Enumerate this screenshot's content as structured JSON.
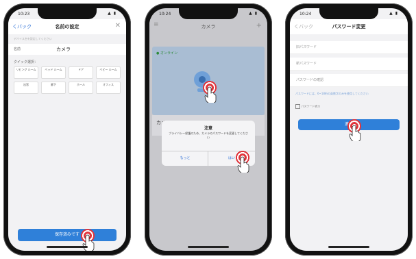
{
  "phone1": {
    "time": "10:23",
    "nav_back": "くバック",
    "nav_title": "名前の設定",
    "nav_close": "✕",
    "hint": "デバイス名を設定してください",
    "name_label": "名前",
    "name_value": "カメラ",
    "quick_label": "クイック選択：",
    "quick_options": [
      "リビング ルーム",
      "ベッド ルーム",
      "ドア",
      "ベビー ルーム",
      "出窓",
      "廊下",
      "ホール",
      "オフィス"
    ],
    "save_button": "保存済みです"
  },
  "phone2": {
    "time": "10:24",
    "nav_title": "カメラ",
    "status_online": "● オンライン",
    "camera_name_partial": "カメ",
    "dialog_title": "注意",
    "dialog_body": "プライバシー保護のため、カメラのパスワードを変更してください",
    "dialog_cancel": "もっと",
    "dialog_ok": "はい"
  },
  "phone3": {
    "time": "10:24",
    "nav_back": "くバック",
    "nav_title": "パスワード変更",
    "old_password": "旧パスワード",
    "new_password": "新パスワード",
    "confirm_password": "パスワードの確認",
    "hint": "パスワードには、6~18桁の英数字のみを使用してください",
    "show_password": "パスワード表示",
    "apply_button": "適用"
  },
  "colors": {
    "accent": "#2f80d9",
    "tap": "#e0353c",
    "online": "#3bb54a"
  }
}
